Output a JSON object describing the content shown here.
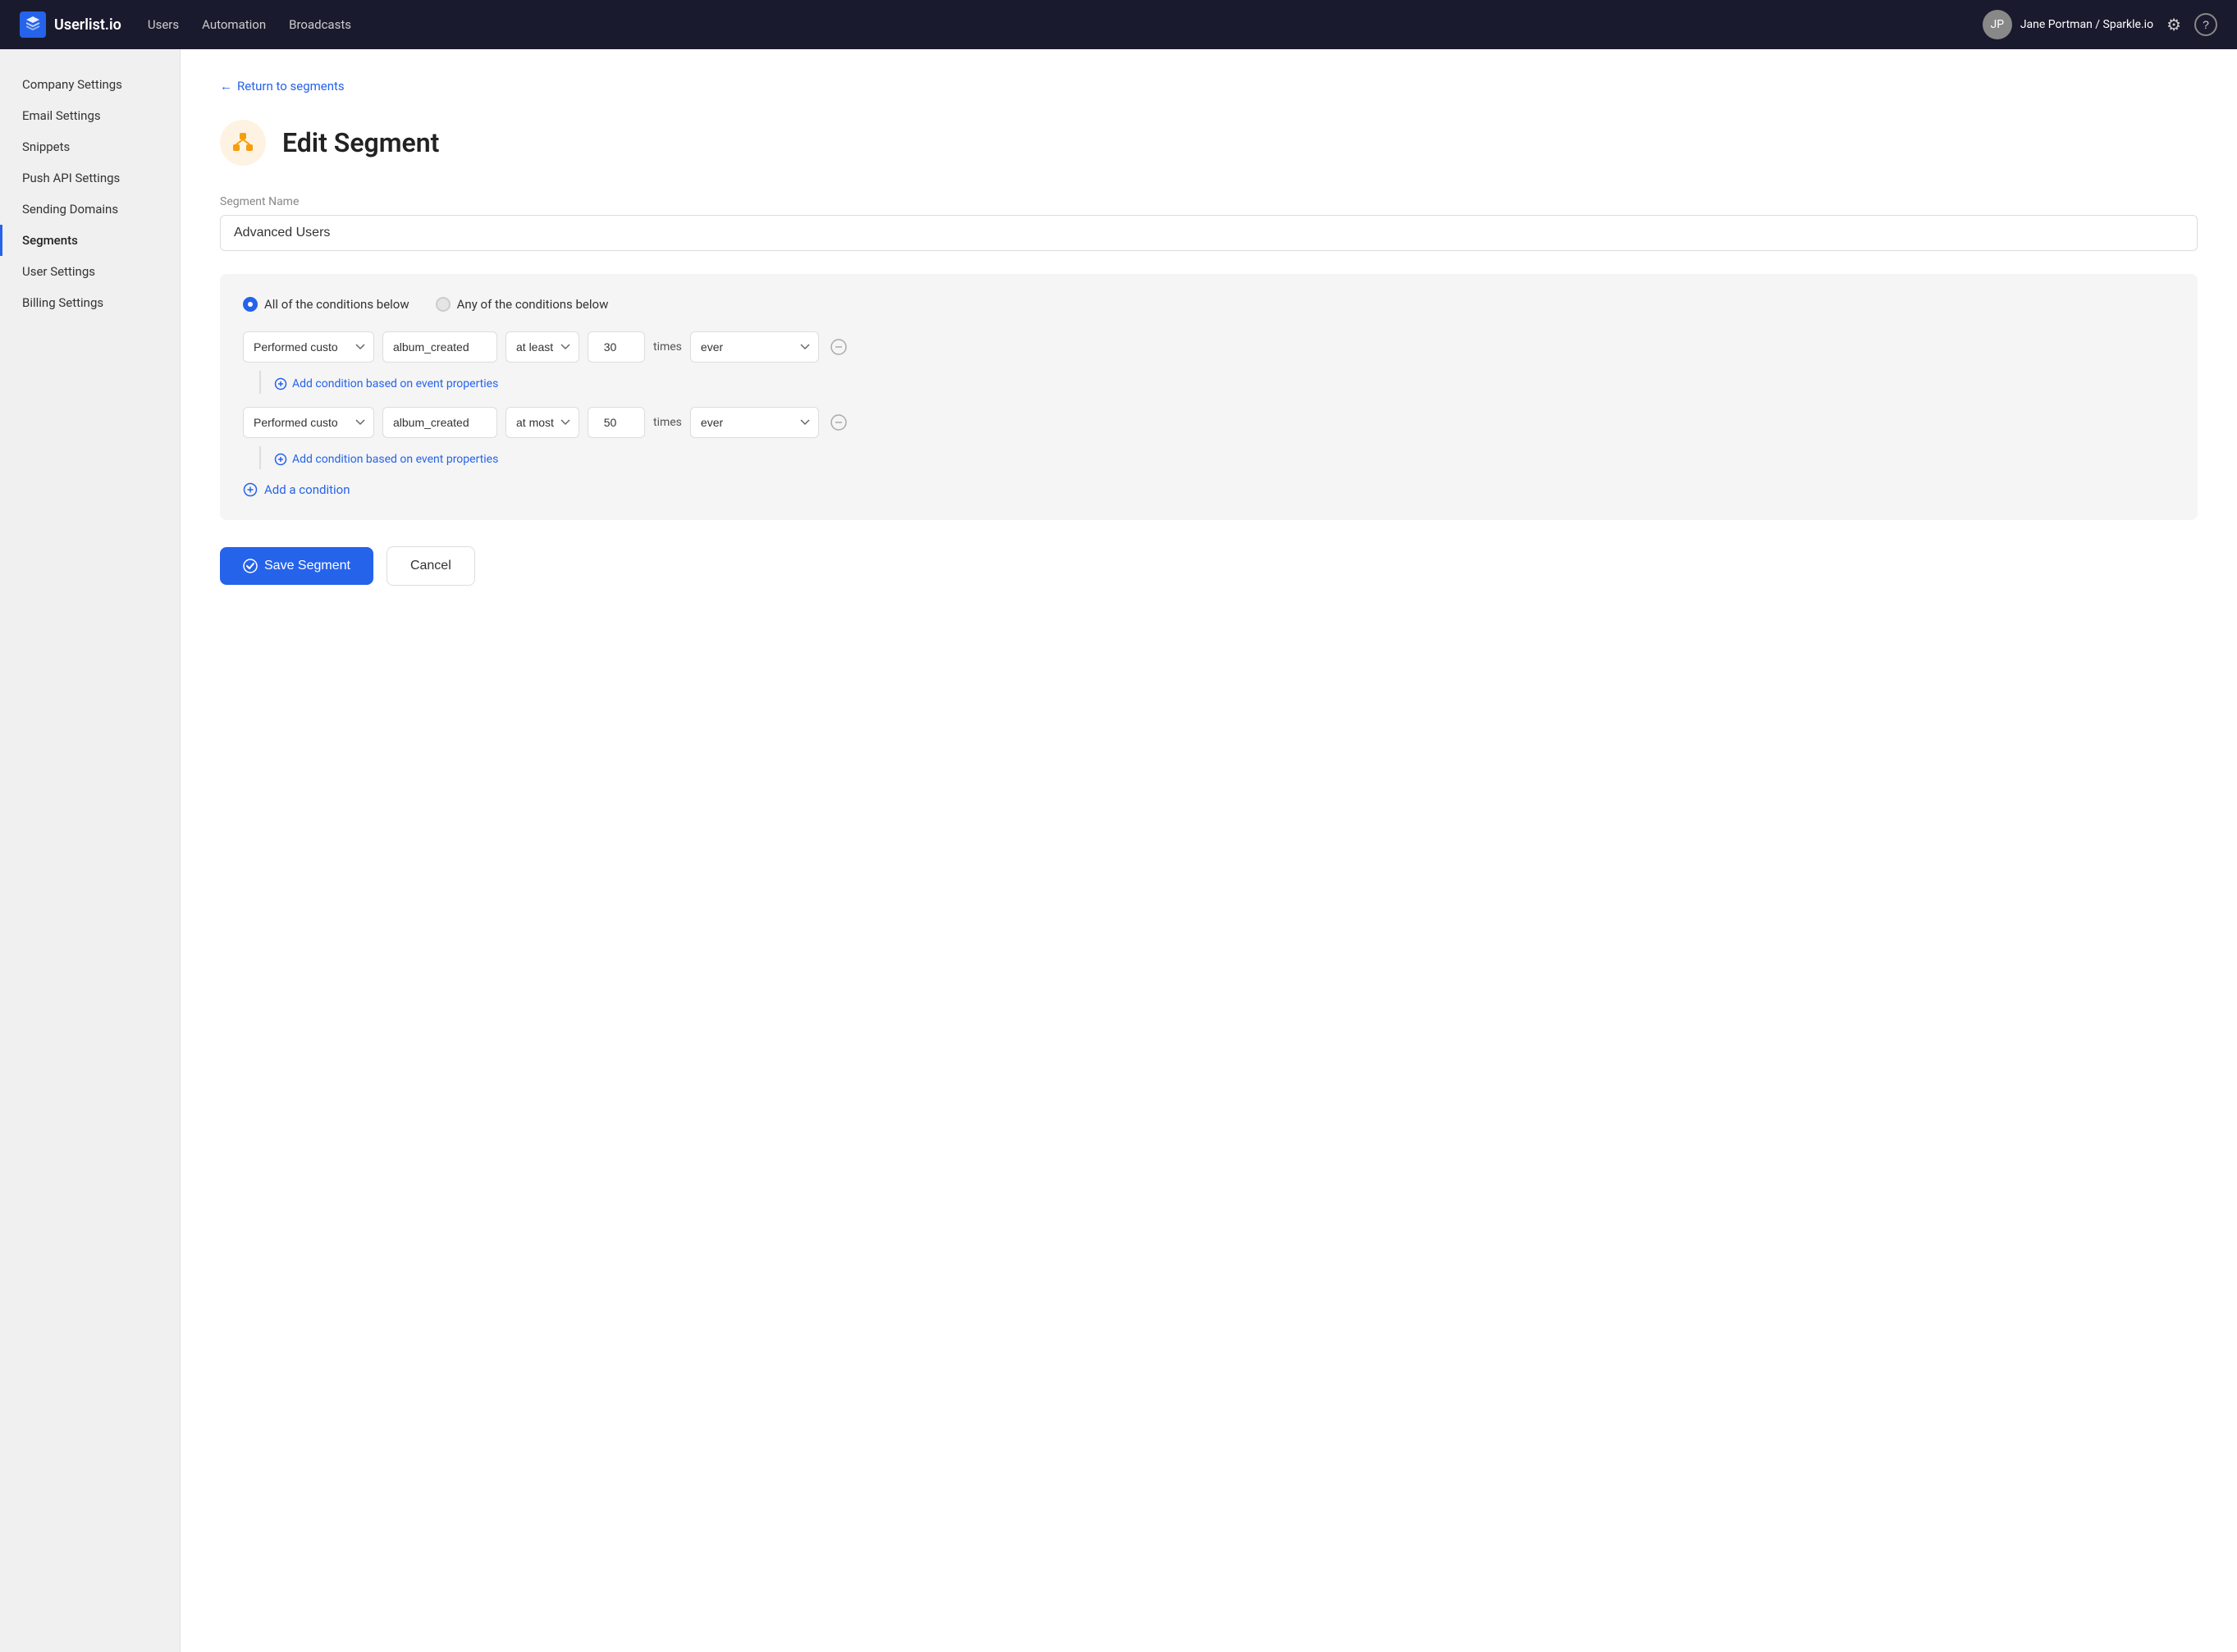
{
  "app": {
    "name": "Userlist.io",
    "logo_text": "Userlist.io"
  },
  "nav": {
    "links": [
      {
        "label": "Users",
        "id": "users"
      },
      {
        "label": "Automation",
        "id": "automation"
      },
      {
        "label": "Broadcasts",
        "id": "broadcasts"
      }
    ]
  },
  "user": {
    "name": "Jane Portman / Sparkle.io",
    "avatar_initials": "JP"
  },
  "sidebar": {
    "items": [
      {
        "label": "Company Settings",
        "id": "company-settings",
        "active": false
      },
      {
        "label": "Email Settings",
        "id": "email-settings",
        "active": false
      },
      {
        "label": "Snippets",
        "id": "snippets",
        "active": false
      },
      {
        "label": "Push API Settings",
        "id": "push-api-settings",
        "active": false
      },
      {
        "label": "Sending Domains",
        "id": "sending-domains",
        "active": false
      },
      {
        "label": "Segments",
        "id": "segments",
        "active": true
      },
      {
        "label": "User Settings",
        "id": "user-settings",
        "active": false
      },
      {
        "label": "Billing Settings",
        "id": "billing-settings",
        "active": false
      }
    ]
  },
  "main": {
    "back_link": "Return to segments",
    "page_title": "Edit Segment",
    "page_icon": "🗂",
    "form": {
      "segment_name_label": "Segment Name",
      "segment_name_value": "Advanced Users",
      "segment_name_placeholder": "Segment Name"
    },
    "conditions": {
      "match_all_label": "All of the conditions below",
      "match_any_label": "Any of the conditions below",
      "match_all_selected": true,
      "rows": [
        {
          "id": "row1",
          "type_value": "Performed custo",
          "event_value": "album_created",
          "operator_value": "at least",
          "count_value": "30",
          "times_label": "times",
          "period_value": "ever",
          "add_prop_label": "Add condition based on event properties"
        },
        {
          "id": "row2",
          "type_value": "Performed custo",
          "event_value": "album_created",
          "operator_value": "at most",
          "count_value": "50",
          "times_label": "times",
          "period_value": "ever",
          "add_prop_label": "Add condition based on event properties"
        }
      ],
      "add_condition_label": "Add a condition"
    },
    "buttons": {
      "save_label": "Save Segment",
      "cancel_label": "Cancel"
    }
  },
  "icons": {
    "gear": "⚙",
    "help": "?",
    "plus": "+",
    "minus": "−",
    "check": "✓",
    "arrow_left": "←"
  }
}
